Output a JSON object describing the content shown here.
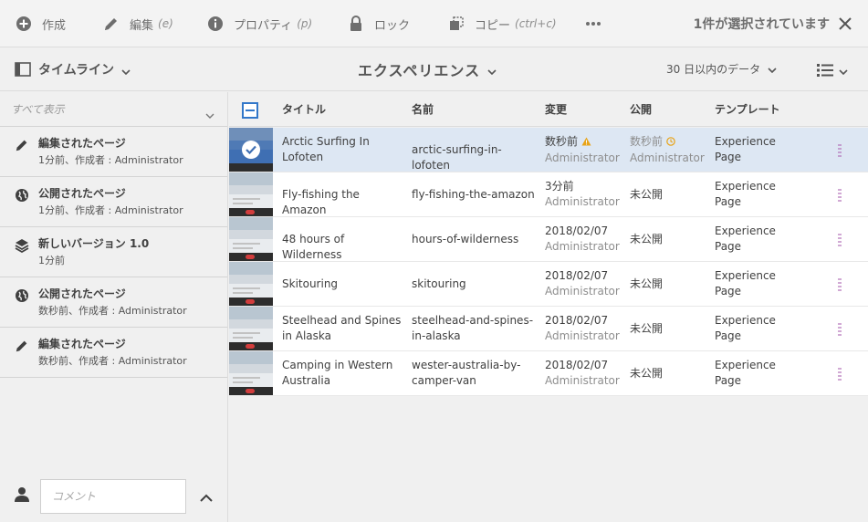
{
  "actionbar": {
    "create": {
      "label": "作成",
      "icon": "plus-circle-icon"
    },
    "edit": {
      "label": "編集",
      "hint": "(e)",
      "icon": "pencil-icon"
    },
    "properties": {
      "label": "プロパティ",
      "hint": "(p)",
      "icon": "info-icon"
    },
    "lock": {
      "label": "ロック",
      "icon": "lock-icon"
    },
    "copy": {
      "label": "コピー",
      "hint": "(ctrl+c)",
      "icon": "copy-icon"
    },
    "more": {
      "icon": "more-horizontal-icon"
    },
    "selection_count": "1件が選択されています",
    "close_icon": "close-icon"
  },
  "titlebar": {
    "rail_toggle": {
      "label": "タイムライン",
      "icon": "rail-toggle-icon"
    },
    "title": "エクスペリエンス",
    "date_filter": "30 日以内のデータ",
    "view_icon": "list-view-icon"
  },
  "rail": {
    "filter_label": "すべて表示",
    "items": [
      {
        "title": "編集されたページ",
        "subtitle": "1分前、作成者 : Administrator",
        "icon": "pencil-icon"
      },
      {
        "title": "公開されたページ",
        "subtitle": "1分前、作成者 : Administrator",
        "icon": "globe-icon"
      },
      {
        "title": "新しいバージョン 1.0",
        "subtitle": "1分前",
        "icon": "layers-icon"
      },
      {
        "title": "公開されたページ",
        "subtitle": "数秒前、作成者 : Administrator",
        "icon": "globe-icon"
      },
      {
        "title": "編集されたページ",
        "subtitle": "数秒前、作成者 : Administrator",
        "icon": "pencil-icon"
      }
    ],
    "comment_placeholder": "コメント"
  },
  "list": {
    "columns": {
      "title": "タイトル",
      "name": "名前",
      "modified": "変更",
      "published": "公開",
      "template": "テンプレート"
    },
    "rows": [
      {
        "title": [
          "Arctic Surfing In",
          "Lofoten"
        ],
        "name": [
          "arctic-surfing-in-lofoten"
        ],
        "modified": "数秒前",
        "modified_by": "Administrator",
        "published": "数秒前",
        "published_by": "Administrator",
        "template": [
          "Experience",
          "Page"
        ],
        "selected": true
      },
      {
        "title": [
          "Fly-fishing the Amazon"
        ],
        "name": [
          "fly-fishing-the-amazon"
        ],
        "modified": "3分前",
        "modified_by": "Administrator",
        "published": "未公開",
        "published_by": "",
        "template": [
          "Experience",
          "Page"
        ],
        "selected": false
      },
      {
        "title": [
          "48 hours of Wilderness"
        ],
        "name": [
          "hours-of-wilderness"
        ],
        "modified": "2018/02/07",
        "modified_by": "Administrator",
        "published": "未公開",
        "published_by": "",
        "template": [
          "Experience",
          "Page"
        ],
        "selected": false
      },
      {
        "title": [
          "Skitouring"
        ],
        "name": [
          "skitouring"
        ],
        "modified": "2018/02/07",
        "modified_by": "Administrator",
        "published": "未公開",
        "published_by": "",
        "template": [
          "Experience",
          "Page"
        ],
        "selected": false
      },
      {
        "title": [
          "Steelhead and Spines",
          "in Alaska"
        ],
        "name": [
          "steelhead-and-spines-",
          "in-alaska"
        ],
        "modified": "2018/02/07",
        "modified_by": "Administrator",
        "published": "未公開",
        "published_by": "",
        "template": [
          "Experience",
          "Page"
        ],
        "selected": false
      },
      {
        "title": [
          "Camping in Western",
          "Australia"
        ],
        "name": [
          "wester-australia-by-",
          "camper-van"
        ],
        "modified": "2018/02/07",
        "modified_by": "Administrator",
        "published": "未公開",
        "published_by": "",
        "template": [
          "Experience",
          "Page"
        ],
        "selected": false
      }
    ]
  },
  "colors": {
    "accent": "#3277c9",
    "warning": "#e8a317",
    "selected_row": "#dde7f3",
    "more_dots": "#b06cb6"
  }
}
